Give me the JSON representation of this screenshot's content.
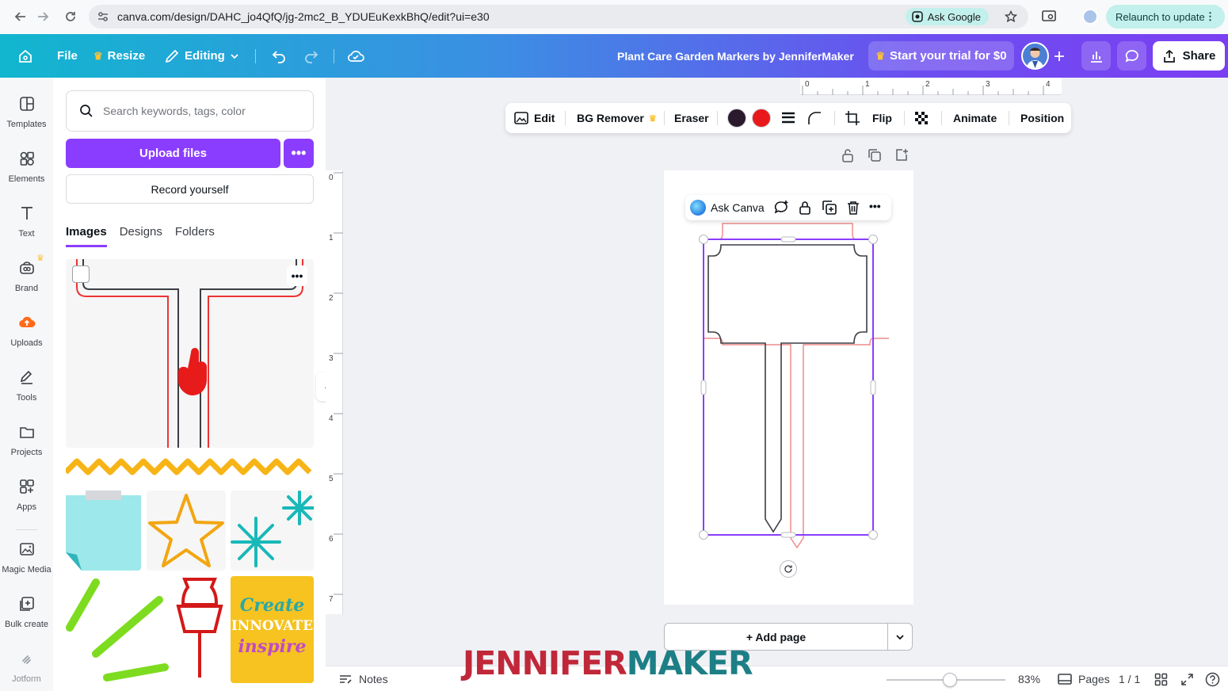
{
  "browser": {
    "url": "canva.com/design/DAHC_jo4QfQ/jg-2mc2_B_YDUEuKexkBhQ/edit?ui=e30",
    "ask_google": "Ask Google",
    "relaunch": "Relaunch to update"
  },
  "header": {
    "file": "File",
    "resize": "Resize",
    "editing": "Editing",
    "title": "Plant Care Garden Markers by JenniferMaker",
    "trial": "Start your trial for $0",
    "share": "Share",
    "accent_gradient": [
      "#11b6cf",
      "#7b3ff2"
    ]
  },
  "rail": {
    "items": [
      {
        "label": "Templates",
        "icon": "templates-icon"
      },
      {
        "label": "Elements",
        "icon": "elements-icon"
      },
      {
        "label": "Text",
        "icon": "text-icon"
      },
      {
        "label": "Brand",
        "icon": "brand-icon"
      },
      {
        "label": "Uploads",
        "icon": "uploads-icon"
      },
      {
        "label": "Tools",
        "icon": "tools-icon"
      },
      {
        "label": "Projects",
        "icon": "projects-icon"
      },
      {
        "label": "Apps",
        "icon": "apps-icon"
      },
      {
        "label": "Magic Media",
        "icon": "magic-media-icon"
      },
      {
        "label": "Bulk create",
        "icon": "bulk-create-icon"
      },
      {
        "label": "Jotform",
        "icon": "jotform-icon"
      }
    ]
  },
  "panel": {
    "search_placeholder": "Search keywords, tags, color",
    "upload": "Upload files",
    "record": "Record yourself",
    "tabs": [
      "Images",
      "Designs",
      "Folders"
    ],
    "active_tab": "Images",
    "thumb_text": [
      "Create",
      "innovate",
      "inspire"
    ]
  },
  "toolbar": {
    "edit": "Edit",
    "bg_remover": "BG Remover",
    "eraser": "Eraser",
    "flip": "Flip",
    "animate": "Animate",
    "position": "Position",
    "colors": [
      "#2b1a2e",
      "#e8191b"
    ]
  },
  "ruler": {
    "top": [
      "0",
      "1",
      "2",
      "3",
      "4"
    ],
    "left": [
      "0",
      "1",
      "2",
      "3",
      "4",
      "5",
      "6",
      "7"
    ]
  },
  "canvas": {
    "ask_canva": "Ask Canva",
    "add_page": "+ Add page"
  },
  "bottom": {
    "notes": "Notes",
    "zoom": "83%",
    "zoom_fraction": 0.48,
    "pages": "Pages",
    "page_count": "1 / 1"
  },
  "watermark": {
    "part1": "JENNIFER",
    "part2": "MAKER"
  }
}
